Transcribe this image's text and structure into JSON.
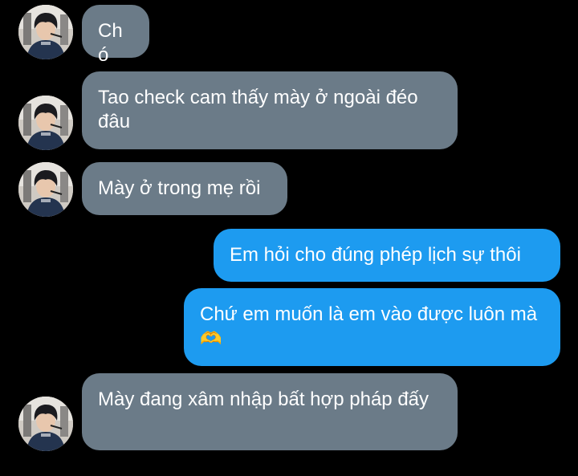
{
  "colors": {
    "background": "#000000",
    "incoming_bubble": "#6b7b88",
    "outgoing_bubble": "#1d9bf0",
    "text": "#ffffff"
  },
  "messages": [
    {
      "side": "incoming",
      "text": "Chó"
    },
    {
      "side": "incoming",
      "text": "Tao check cam thấy mày ở ngoài đéo đâu"
    },
    {
      "side": "incoming",
      "text": "Mày ở trong mẹ rồi"
    },
    {
      "side": "outgoing",
      "text": "Em hỏi cho đúng phép lịch sự thôi"
    },
    {
      "side": "outgoing",
      "text": "Chứ em muốn là em vào được luôn mà",
      "emoji": "🫶"
    },
    {
      "side": "incoming",
      "text": "Mày đang xâm nhập bất hợp pháp đấy"
    }
  ]
}
